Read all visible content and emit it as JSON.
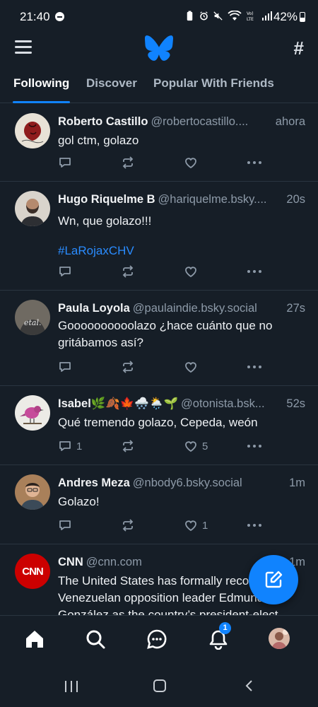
{
  "status_bar": {
    "time": "21:40",
    "battery": "42%"
  },
  "header": {
    "menu_icon": "hamburger-menu-icon",
    "logo": "bluesky-butterfly-logo",
    "feeds_icon": "hash-icon",
    "brand_color": "#1083fe"
  },
  "tabs": [
    {
      "label": "Following",
      "active": true
    },
    {
      "label": "Discover",
      "active": false
    },
    {
      "label": "Popular With Friends",
      "active": false
    }
  ],
  "posts": [
    {
      "name": "Roberto Castillo",
      "handle": "@robertocastillo....",
      "time": "ahora",
      "text": "gol ctm, golazo",
      "hashtag": "",
      "replies": "",
      "likes": ""
    },
    {
      "name": "Hugo Riquelme B",
      "handle": "@hariquelme.bsky....",
      "time": "20s",
      "text": "Wn, que golazo!!!",
      "hashtag": "#LaRojaxCHV",
      "replies": "",
      "likes": ""
    },
    {
      "name": "Paula Loyola",
      "handle": "@paulaindie.bsky.social",
      "time": "27s",
      "text": "Goooooooooolazo ¿hace cuánto que no gritábamos así?",
      "hashtag": "",
      "replies": "",
      "likes": ""
    },
    {
      "name": "Isabel🌿🍂🍁🌨️🌦️🌱",
      "handle": "@otonista.bsk...",
      "time": "52s",
      "text": "Qué tremendo golazo, Cepeda, weón",
      "hashtag": "",
      "replies": "1",
      "likes": "5"
    },
    {
      "name": "Andres Meza",
      "handle": "@nbody6.bsky.social",
      "time": "1m",
      "text": "Golazo!",
      "hashtag": "",
      "replies": "",
      "likes": "1"
    },
    {
      "name": "CNN",
      "handle": "@cnn.com",
      "time": "1m",
      "text": "The United States has formally recognized Venezuelan opposition leader Edmundo González as the country’s president-elect",
      "hashtag": "",
      "replies": "",
      "likes": "",
      "avatar_label": "CNN"
    }
  ],
  "fab": {
    "icon": "compose-icon"
  },
  "bottom_nav": {
    "items": [
      "home-icon",
      "search-icon",
      "chat-icon",
      "bell-icon",
      "profile-avatar"
    ],
    "notification_badge": "1"
  }
}
